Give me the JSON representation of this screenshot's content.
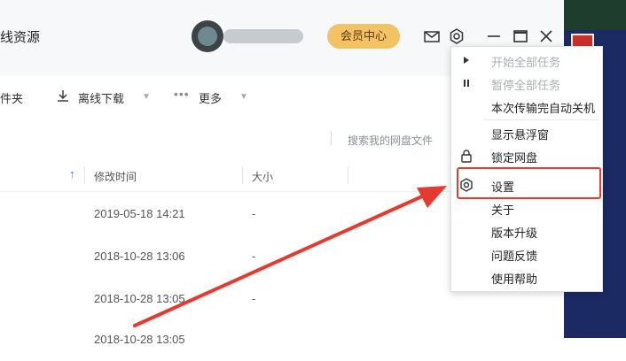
{
  "app": {
    "title": "线资源",
    "vip_label": "会员中心"
  },
  "toolbar": {
    "folder_label": "件夹",
    "offline_download": "离线下载",
    "more": "更多"
  },
  "search": {
    "placeholder": "搜索我的网盘文件"
  },
  "table": {
    "headers": {
      "modified": "修改时间",
      "size": "大小"
    },
    "rows": [
      {
        "time": "2019-05-18 14:21",
        "size": "-"
      },
      {
        "time": "2018-10-28 13:06",
        "size": "-"
      },
      {
        "time": "2018-10-28 13:05",
        "size": "-"
      },
      {
        "time": "2018-10-28 13:05",
        "size": ""
      }
    ]
  },
  "menu": {
    "items": [
      {
        "label": "开始全部任务",
        "icon": "play-icon",
        "disabled": true
      },
      {
        "label": "暂停全部任务",
        "icon": "pause-icon",
        "disabled": true
      },
      {
        "label": "本次传输完自动关机",
        "icon": "",
        "disabled": false
      },
      {
        "label": "显示悬浮窗",
        "icon": "",
        "disabled": false
      },
      {
        "label": "锁定网盘",
        "icon": "lock-icon",
        "disabled": false
      },
      {
        "label": "设置",
        "icon": "gear-icon",
        "disabled": false
      },
      {
        "label": "关于",
        "icon": "",
        "disabled": false
      },
      {
        "label": "版本升级",
        "icon": "",
        "disabled": false
      },
      {
        "label": "问题反馈",
        "icon": "",
        "disabled": false
      },
      {
        "label": "使用帮助",
        "icon": "",
        "disabled": false
      }
    ]
  },
  "colors": {
    "vip_bg": "#f2c264",
    "highlight": "#e53a2f",
    "arrow": "#e53a2f"
  }
}
